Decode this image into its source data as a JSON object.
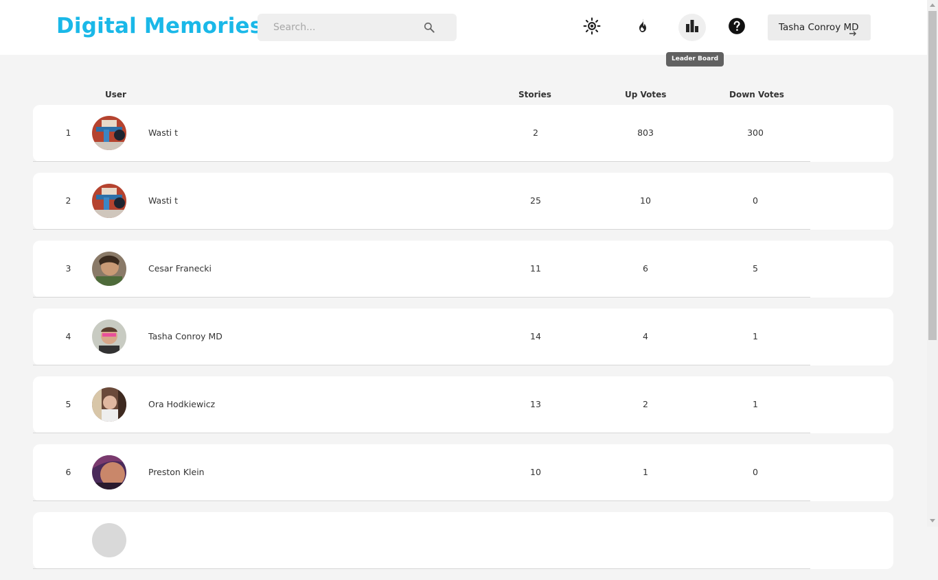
{
  "header": {
    "logo": "Digital Memories",
    "search_placeholder": "Search...",
    "icons": [
      "brightness-icon",
      "fire-icon",
      "leaderboard-icon",
      "help-icon"
    ],
    "tooltip": "Leader Board",
    "user_button": "Tasha Conroy MD"
  },
  "table": {
    "columns": {
      "user": "User",
      "stories": "Stories",
      "up_votes": "Up Votes",
      "down_votes": "Down Votes"
    },
    "rows": [
      {
        "rank": "1",
        "name": "Wasti t",
        "stories": "2",
        "up_votes": "803",
        "down_votes": "300"
      },
      {
        "rank": "2",
        "name": "Wasti t",
        "stories": "25",
        "up_votes": "10",
        "down_votes": "0"
      },
      {
        "rank": "3",
        "name": "Cesar Franecki",
        "stories": "11",
        "up_votes": "6",
        "down_votes": "5"
      },
      {
        "rank": "4",
        "name": "Tasha Conroy MD",
        "stories": "14",
        "up_votes": "4",
        "down_votes": "1"
      },
      {
        "rank": "5",
        "name": "Ora Hodkiewicz",
        "stories": "13",
        "up_votes": "2",
        "down_votes": "1"
      },
      {
        "rank": "6",
        "name": "Preston Klein",
        "stories": "10",
        "up_votes": "1",
        "down_votes": "0"
      }
    ]
  },
  "colors": {
    "brand": "#1ab8e8",
    "background": "#f4f4f4",
    "card": "#ffffff"
  }
}
